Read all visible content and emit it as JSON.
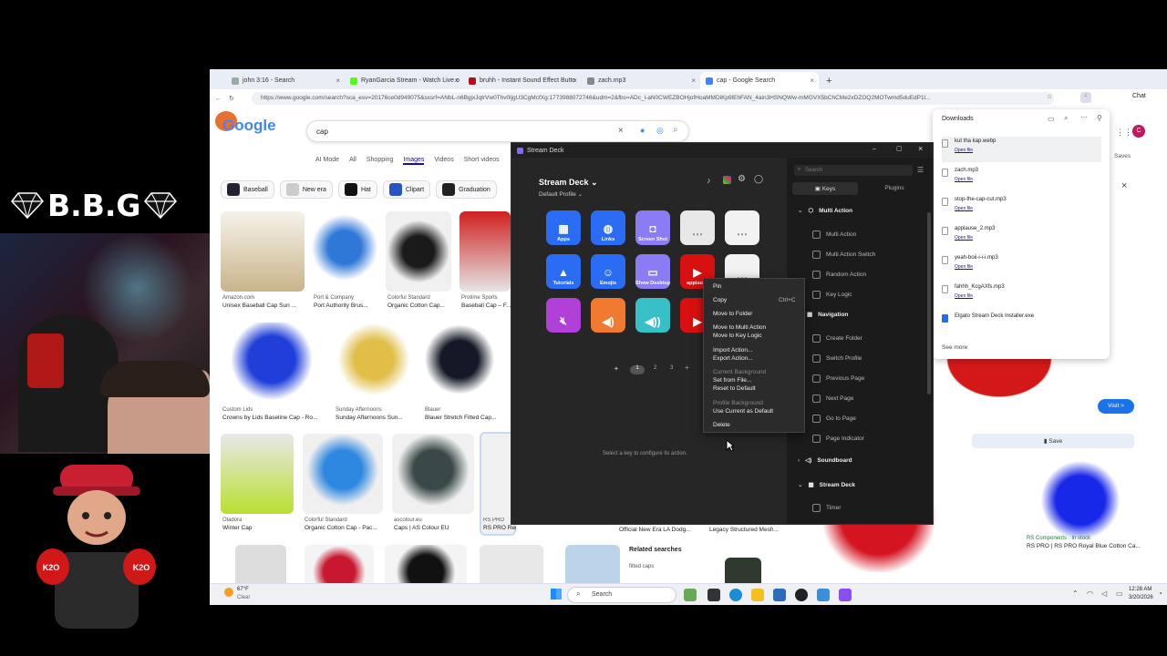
{
  "overlay": {
    "brand": "B.B.G",
    "avatar_badge": "K2O"
  },
  "browser": {
    "tabs": [
      {
        "label": "john 3:16 - Search",
        "color": "#9aa"
      },
      {
        "label": "RyanGarcia Stream - Watch Live o",
        "color": "#53fc18"
      },
      {
        "label": "bruhh - Instant Sound Effect Butto",
        "color": "#b01020"
      },
      {
        "label": "zach.mp3",
        "color": "#888"
      },
      {
        "label": "cap - Google Search",
        "color": "#4285f4"
      }
    ],
    "new_tab": "+",
    "url": "https://www.google.com/search?sca_esv=20176ce0d949075&sxsrf=ANbL-n6BgjxJqtrVw0Thv0ljgU3CgMcfXg:1773988072746&udm=2&fbs=ADc_l-aN0CWEZBOHjofHoaMMDiKp9lEhFAN_4ain3HSNQWw-mMGVX5bChCMe2xDZOQ2MOTwmd5duEdP1l...",
    "chat_label": "Chat"
  },
  "google": {
    "logo": "Google",
    "query": "cap",
    "filters": [
      "AI Mode",
      "All",
      "Shopping",
      "Images",
      "Videos",
      "Short videos"
    ],
    "active_filter": "Images",
    "chips": [
      "Baseball",
      "New era",
      "Hat",
      "Clipart",
      "Graduation"
    ],
    "results": [
      {
        "source": "Amazon.com",
        "title": "Unisex Baseball Cap Sun ..."
      },
      {
        "source": "Port & Company",
        "title": "Port Authority Brus..."
      },
      {
        "source": "Colorful Standard",
        "title": "Organic Cotton Cap..."
      },
      {
        "source": "Protime Sports",
        "title": "Baseball Cap – F..."
      },
      {
        "source": "Custom Lids",
        "title": "Crowns by Lids Baseline Cap - Ro..."
      },
      {
        "source": "Sunday Afternoons",
        "title": "Sunday Afternoons Sun..."
      },
      {
        "source": "Blauer",
        "title": "Blauer Stretch Fitted Cap..."
      },
      {
        "source": "Oladora",
        "title": "Winter Cap"
      },
      {
        "source": "Colorful Standard",
        "title": "Organic Cotton Cap - Pac..."
      },
      {
        "source": "ascolour.eu",
        "title": "Caps | AS Colour EU"
      },
      {
        "source": "RS PRO",
        "title": "RS PRO Red Cotton Cap | RS"
      },
      {
        "source": "",
        "title": "Official New Era LA Dodg..."
      },
      {
        "source": "",
        "title": "Legacy Structured Mesh..."
      },
      {
        "source": "RS Components · In stock",
        "title": "RS PRO | RS PRO Royal Blue Cotton Ca..."
      }
    ],
    "related_searches": "Related searches",
    "related_item": "fitted caps",
    "visit_label": "Visit >",
    "save_label": "Save",
    "saves_label": "Saves"
  },
  "downloads": {
    "title": "Downloads",
    "open_file": "Open file",
    "items": [
      "kut tha kap.webp",
      "zach.mp3",
      "stop-the-cap-cut.mp3",
      "applause_2.mp3",
      "yeah-boii-i-i-i.mp3",
      "fahhh_KcgAXfs.mp3",
      "Elgato Stream Deck Installer.exe"
    ],
    "see_more": "See more"
  },
  "streamdeck": {
    "window_title": "Stream Deck",
    "heading": "Stream Deck",
    "profile": "Default Profile",
    "keys": [
      {
        "label": "Apps",
        "bg": "#2a6df4"
      },
      {
        "label": "Links",
        "bg": "#2a6df4"
      },
      {
        "label": "Screen Shot",
        "bg": "#8a7cf4"
      },
      {
        "label": "",
        "bg": "#e8e8e8"
      },
      {
        "label": "",
        "bg": "#f2f2f2"
      },
      {
        "label": "Tutorials",
        "bg": "#2a6df4"
      },
      {
        "label": "Emojis",
        "bg": "#2a6df4"
      },
      {
        "label": "Show Desktop",
        "bg": "#8a7cf4"
      },
      {
        "label": "applause",
        "bg": "#d81010"
      },
      {
        "label": "",
        "bg": "#f2f2f2"
      },
      {
        "label": "",
        "bg": "#b040d8"
      },
      {
        "label": "",
        "bg": "#f07a30"
      },
      {
        "label": "",
        "bg": "#38c0c8"
      },
      {
        "label": "",
        "bg": "#d81010"
      }
    ],
    "pages": [
      "1",
      "2",
      "3"
    ],
    "hint": "Select a key to configure its action.",
    "search_placeholder": "Search",
    "tab_keys": "Keys",
    "tab_plugins": "Plugins",
    "sections": {
      "multi_action": "Multi Action",
      "navigation": "Navigation",
      "soundboard": "Soundboard",
      "stream_deck": "Stream Deck"
    },
    "multi_items": [
      "Multi Action",
      "Multi Action Switch",
      "Random Action",
      "Key Logic"
    ],
    "nav_items": [
      "Create Folder",
      "Switch Profile",
      "Previous Page",
      "Next Page",
      "Go to Page",
      "Page Indicator"
    ],
    "sd_items": [
      "Timer"
    ]
  },
  "context_menu": {
    "pin": "Pin",
    "copy": "Copy",
    "copy_shortcut": "Ctrl+C",
    "move_folder": "Move to Folder",
    "move_multi": "Move to Multi Action",
    "move_logic": "Move to Key Logic",
    "import": "Import Action...",
    "export": "Export Action...",
    "current_bg": "Current Background",
    "set_file": "Set from File...",
    "reset": "Reset to Default",
    "profile_bg": "Profile Background",
    "use_current": "Use Current as Default",
    "delete": "Delete"
  },
  "taskbar": {
    "temp": "67°F",
    "weather": "Clear",
    "search": "Search",
    "time": "12:28 AM",
    "date": "3/20/2026"
  }
}
